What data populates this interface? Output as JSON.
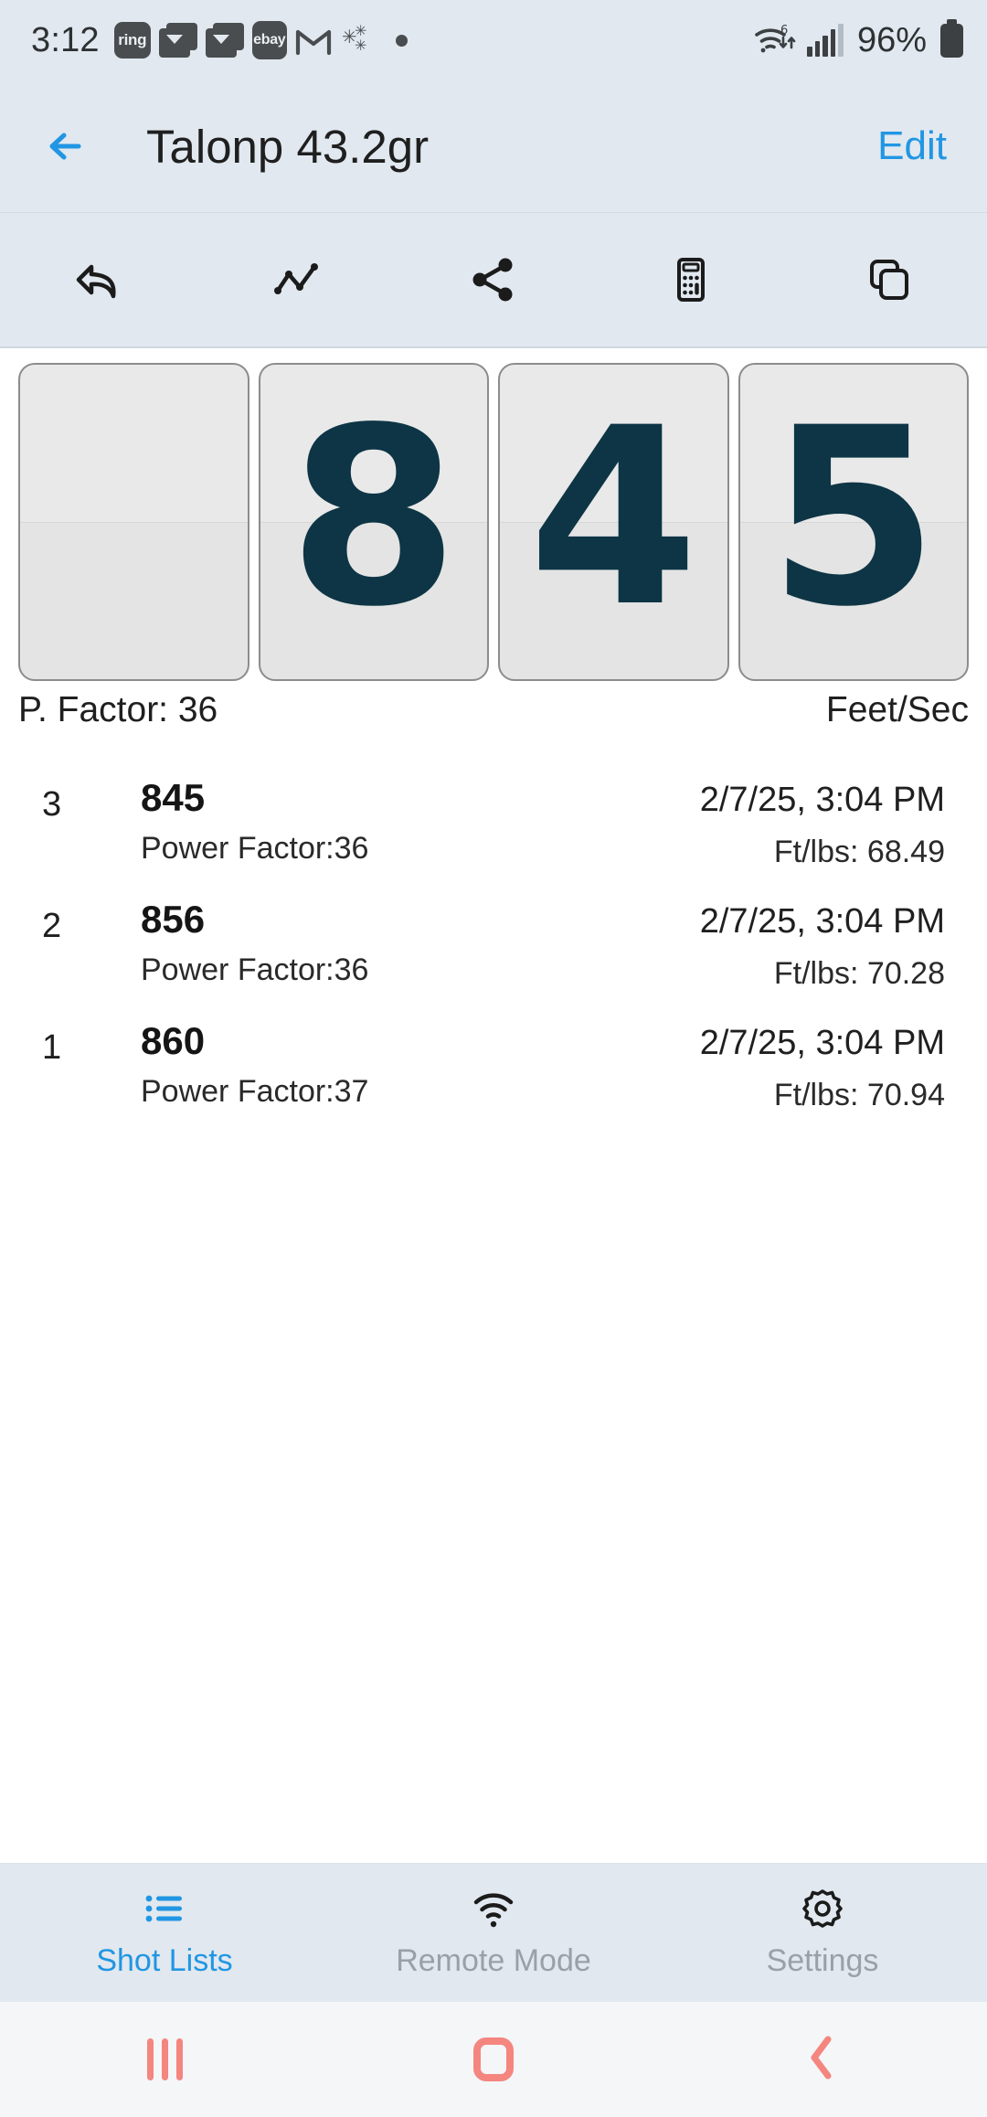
{
  "status_bar": {
    "time": "3:12",
    "left_icons": [
      {
        "name": "ring-notification-icon",
        "label": "ring"
      },
      {
        "name": "mail-notification-icon",
        "label": ""
      },
      {
        "name": "mail-notification-icon-2",
        "label": ""
      },
      {
        "name": "ebay-notification-icon",
        "label": "ebay"
      },
      {
        "name": "gmail-notification-icon",
        "label": "M"
      },
      {
        "name": "sparkle-notification-icon",
        "label": ""
      },
      {
        "name": "more-notifications-dot",
        "label": ""
      }
    ],
    "wifi": "wifi-6-icon",
    "signal": "cellular-signal-icon",
    "battery_percent": "96%",
    "battery": "battery-icon"
  },
  "header": {
    "back_label": "back-arrow-icon",
    "title": "Talonp 43.2gr",
    "edit_label": "Edit",
    "accent_color": "#2196e3"
  },
  "toolbar": {
    "buttons": [
      {
        "name": "undo-icon",
        "label": "Undo"
      },
      {
        "name": "line-chart-icon",
        "label": "Chart"
      },
      {
        "name": "share-icon",
        "label": "Share"
      },
      {
        "name": "calculator-icon",
        "label": "Calculator"
      },
      {
        "name": "copy-icon",
        "label": "Copy"
      }
    ]
  },
  "readout": {
    "digits": [
      "",
      "8",
      "4",
      "5"
    ],
    "value": "845",
    "power_factor_label": "P. Factor: 36",
    "unit_label": "Feet/Sec",
    "digit_color": "#0d3545"
  },
  "shots": {
    "rows": [
      {
        "index": "3",
        "speed": "845",
        "power_factor": "Power Factor:36",
        "timestamp": "2/7/25, 3:04 PM",
        "energy": "Ft/lbs: 68.49"
      },
      {
        "index": "2",
        "speed": "856",
        "power_factor": "Power Factor:36",
        "timestamp": "2/7/25, 3:04 PM",
        "energy": "Ft/lbs: 70.28"
      },
      {
        "index": "1",
        "speed": "860",
        "power_factor": "Power Factor:37",
        "timestamp": "2/7/25, 3:04 PM",
        "energy": "Ft/lbs: 70.94"
      }
    ]
  },
  "tabbar": {
    "tabs": [
      {
        "name": "tab-shot-lists",
        "label": "Shot Lists",
        "icon": "list-icon",
        "active": true
      },
      {
        "name": "tab-remote-mode",
        "label": "Remote Mode",
        "icon": "wifi-icon",
        "active": false
      },
      {
        "name": "tab-settings",
        "label": "Settings",
        "icon": "gear-icon",
        "active": false
      }
    ],
    "active_color": "#2196e3",
    "inactive_color": "#9aa0a6"
  },
  "navbar": {
    "buttons": [
      {
        "name": "nav-recents-button",
        "label": "Recents"
      },
      {
        "name": "nav-home-button",
        "label": "Home"
      },
      {
        "name": "nav-back-button",
        "label": "Back"
      }
    ],
    "color": "#f4867f"
  }
}
